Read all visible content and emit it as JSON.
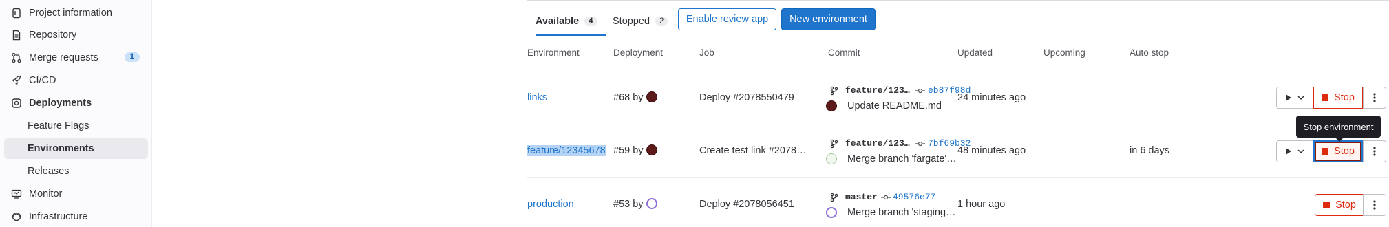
{
  "sidebar": {
    "items": [
      {
        "label": "Project information",
        "icon": "info-icon"
      },
      {
        "label": "Repository",
        "icon": "document-icon"
      },
      {
        "label": "Merge requests",
        "icon": "merge-request-icon",
        "count": "1"
      },
      {
        "label": "CI/CD",
        "icon": "rocket-icon"
      },
      {
        "label": "Deployments",
        "icon": "deployments-icon"
      },
      {
        "label": "Feature Flags"
      },
      {
        "label": "Environments"
      },
      {
        "label": "Releases"
      },
      {
        "label": "Monitor",
        "icon": "monitor-icon"
      },
      {
        "label": "Infrastructure",
        "icon": "infrastructure-icon"
      }
    ],
    "active_item": "Environments"
  },
  "tabs": [
    {
      "label": "Available",
      "count": "4"
    },
    {
      "label": "Stopped",
      "count": "2"
    }
  ],
  "buttons": {
    "enable_review_app": "Enable review app",
    "new_environment": "New environment"
  },
  "table": {
    "headers": [
      "Environment",
      "Deployment",
      "Job",
      "Commit",
      "Updated",
      "Upcoming",
      "Auto stop"
    ],
    "rows": [
      {
        "environment": "links",
        "deployment": "#68 by",
        "job": "Deploy #2078550479",
        "branch": "feature/123…",
        "sha": "eb87f98d",
        "commit_message": "Update README.md",
        "updated": "24 minutes ago",
        "auto_stop": "",
        "stop_label": "Stop"
      },
      {
        "environment": "feature/12345678",
        "deployment": "#59 by",
        "job": "Create test link #2078…",
        "branch": "feature/123…",
        "sha": "7bf69b32",
        "commit_message": "Merge branch 'fargate'…",
        "updated": "48 minutes ago",
        "auto_stop": "in 6 days",
        "stop_label": "Stop"
      },
      {
        "environment": "production",
        "deployment": "#53 by",
        "job": "Deploy #2078056451",
        "branch": "master",
        "sha": "49576e77",
        "commit_message": "Merge branch 'staging…",
        "updated": "1 hour ago",
        "auto_stop": "",
        "stop_label": "Stop"
      }
    ]
  },
  "tooltip": "Stop environment",
  "colors": {
    "accent": "#1f75cb",
    "danger": "#dd2b0e",
    "text": "#333238"
  }
}
